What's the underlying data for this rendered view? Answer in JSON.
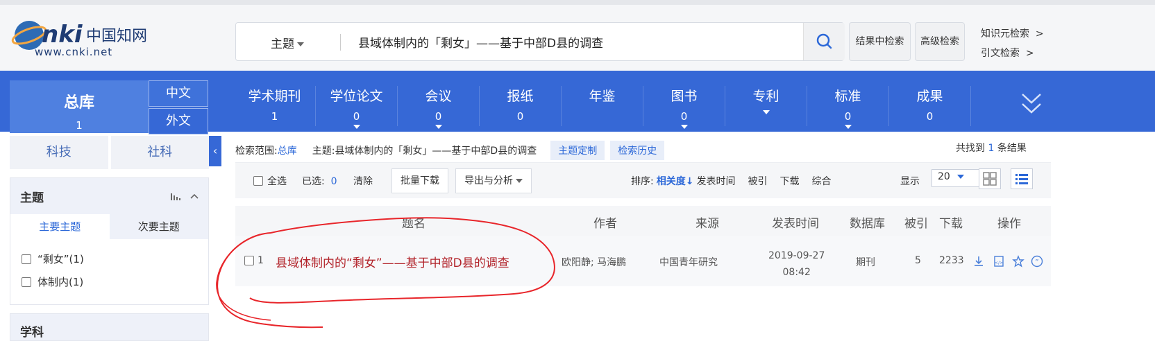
{
  "header": {
    "logo_text": "CNKI中国知网",
    "logo_url_text": "www.cnki.net",
    "search_field": "主题",
    "search_query": "县域体制内的「剩女」——基于中部D县的调查",
    "btn_result_search": "结果中检索",
    "btn_advanced": "高级检索",
    "link_knowledge": "知识元检索",
    "link_citation": "引文检索"
  },
  "nav": {
    "total": {
      "label": "总库",
      "count": "1"
    },
    "lang_cn": "中文",
    "lang_foreign": "外文",
    "items": [
      {
        "label": "学术期刊",
        "count": "1",
        "dropdown": false
      },
      {
        "label": "学位论文",
        "count": "0",
        "dropdown": true
      },
      {
        "label": "会议",
        "count": "0",
        "dropdown": true
      },
      {
        "label": "报纸",
        "count": "0",
        "dropdown": false
      },
      {
        "label": "年鉴",
        "count": "",
        "dropdown": false
      },
      {
        "label": "图书",
        "count": "0",
        "dropdown": true
      },
      {
        "label": "专利",
        "count": "",
        "dropdown": true
      },
      {
        "label": "标准",
        "count": "0",
        "dropdown": true
      },
      {
        "label": "成果",
        "count": "0",
        "dropdown": false
      }
    ]
  },
  "sidebar": {
    "tab_sci": "科技",
    "tab_soc": "社科",
    "facet_topic": "主题",
    "subtab_major": "主要主题",
    "subtab_minor": "次要主题",
    "facet_items": [
      {
        "label": "“剩女”(1)"
      },
      {
        "label": "体制内(1)"
      }
    ],
    "facet_subject": "学科"
  },
  "scope": {
    "label": "检索范围:",
    "value": "总库",
    "topic_label": "主题:",
    "topic_value": "县域体制内的「剩女」——基于中部D县的调查",
    "btn_custom": "主题定制",
    "btn_history": "检索历史"
  },
  "result_count": {
    "prefix": "共找到",
    "count": "1",
    "suffix": "条结果"
  },
  "toolbar": {
    "select_all": "全选",
    "selected_label": "已选:",
    "selected_count": "0",
    "clear": "清除",
    "batch_download": "批量下载",
    "export": "导出与分析",
    "sort_label": "排序:",
    "sort_relevance": "相关度",
    "sort_date": "发表时间",
    "sort_cited": "被引",
    "sort_download": "下载",
    "sort_combined": "综合",
    "display_label": "显示",
    "display_value": "20"
  },
  "table": {
    "headers": {
      "title": "题名",
      "author": "作者",
      "source": "来源",
      "date": "发表时间",
      "db": "数据库",
      "cited": "被引",
      "downloads": "下载",
      "ops": "操作"
    },
    "rows": [
      {
        "index": "1",
        "title": "县域体制内的“剩女”——基于中部D县的调查",
        "authors": "欧阳静; 马海鹏",
        "source": "中国青年研究",
        "date": "2019-09-27",
        "time": "08:42",
        "db": "期刊",
        "cited": "5",
        "downloads": "2233"
      }
    ]
  },
  "colors": {
    "nav_blue": "#3668d6",
    "link_blue": "#2c68d8",
    "title_red": "#b2232a",
    "scribble_red": "#e8262b"
  }
}
